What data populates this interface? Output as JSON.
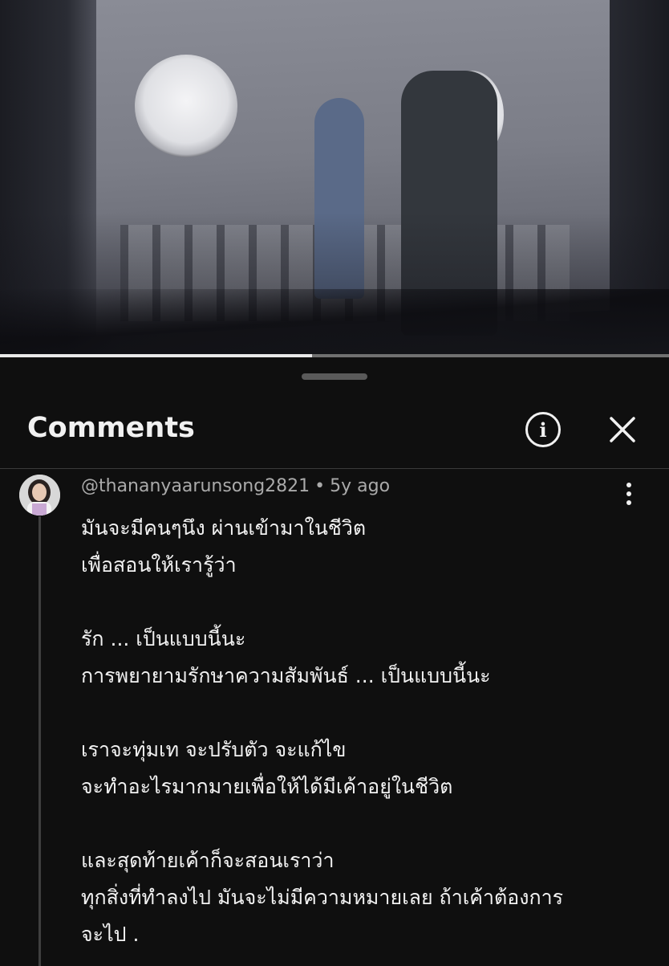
{
  "video": {
    "progress": 0.466
  },
  "comments_panel": {
    "title": "Comments",
    "info_icon": "info-icon",
    "close_icon": "close-icon"
  },
  "comment": {
    "author": "@thananyaarunsong2821",
    "separator": "•",
    "age": "5y ago",
    "lines": [
      "มันจะมีคนๆนึง ผ่านเข้ามาในชีวิต",
      "เพื่อสอนให้เรารู้ว่า",
      "",
      "รัก ...  เป็นแบบนี้นะ",
      "การพยายามรักษาความสัมพันธ์ ... เป็นแบบนี้นะ",
      "",
      "เราจะทุ่มเท จะปรับตัว จะแก้ไข",
      "จะทำอะไรมากมายเพื่อให้ได้มีเค้าอยู่ในชีวิต",
      "",
      "และสุดท้ายเค้าก็จะสอนเราว่า",
      "ทุกสิ่งที่ทำลงไป มันจะไม่มีความหมายเลย ถ้าเค้าต้องการ",
      "จะไป ."
    ]
  }
}
